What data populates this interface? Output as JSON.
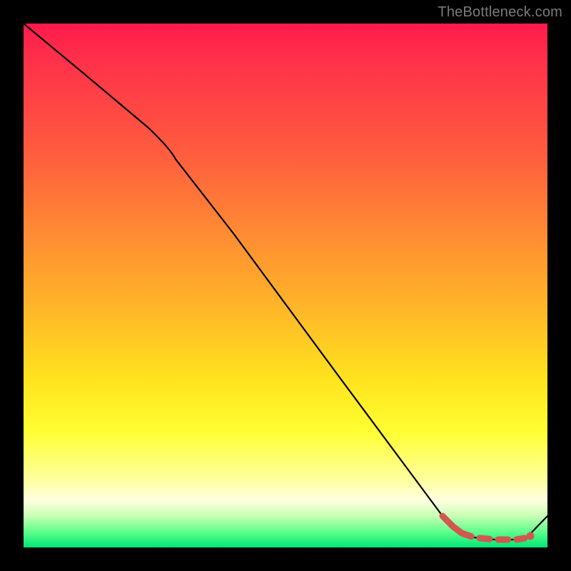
{
  "watermark": "TheBottleneck.com",
  "colors": {
    "background": "#000000",
    "line_main": "#000000",
    "line_accent": "#d0584f",
    "gradient_top": "#ff1a4d",
    "gradient_bottom": "#00e676"
  },
  "chart_data": {
    "type": "line",
    "title": "",
    "xlabel": "",
    "ylabel": "",
    "xlim": [
      0,
      100
    ],
    "ylim": [
      0,
      100
    ],
    "grid": false,
    "legend": false,
    "series": [
      {
        "name": "main-curve",
        "color": "#000000",
        "x": [
          0,
          12,
          24,
          28,
          40,
          60,
          80,
          82,
          86,
          90,
          94,
          96,
          100
        ],
        "y": [
          100,
          90,
          80,
          76,
          60,
          33,
          6,
          4,
          2,
          1.5,
          1.5,
          2,
          6
        ]
      },
      {
        "name": "accent-segment",
        "color": "#d0584f",
        "style": "dashed-then-dot",
        "x": [
          80,
          82,
          84,
          86,
          88,
          90,
          92,
          94,
          96
        ],
        "y": [
          6,
          4,
          3,
          2,
          1.8,
          1.6,
          1.5,
          1.5,
          2
        ]
      }
    ],
    "annotations": []
  }
}
